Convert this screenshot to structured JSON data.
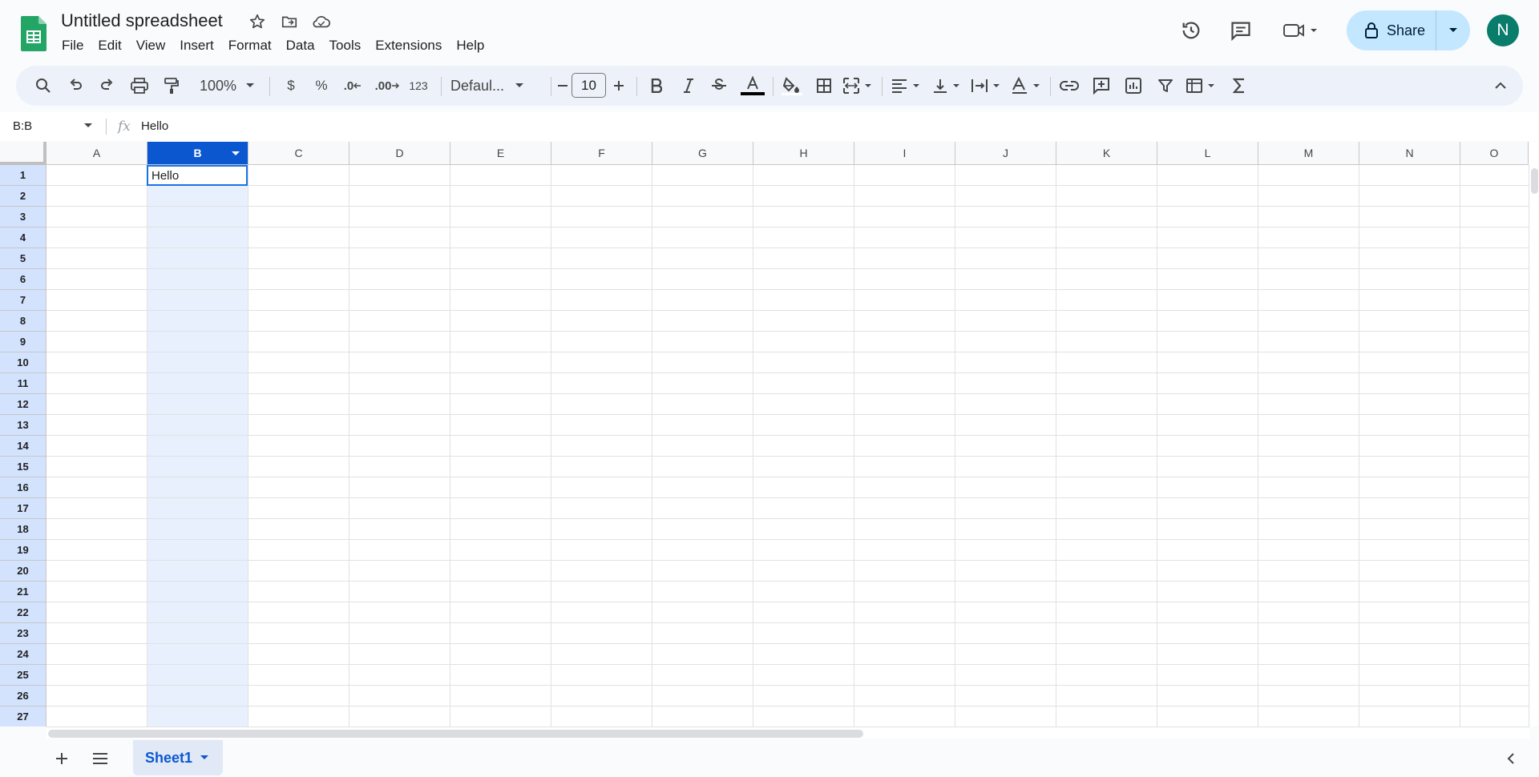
{
  "app": {
    "title": "Untitled spreadsheet",
    "menu": [
      "File",
      "Edit",
      "View",
      "Insert",
      "Format",
      "Data",
      "Tools",
      "Extensions",
      "Help"
    ],
    "share_label": "Share",
    "avatar_initial": "N",
    "accent": "#0b57d0"
  },
  "toolbar": {
    "zoom": "100%",
    "currency": "$",
    "percent": "%",
    "decrease_decimal": ".0",
    "increase_decimal": ".00",
    "number_format": "123",
    "font": "Defaul...",
    "font_size": "10"
  },
  "formula_bar": {
    "name_box": "B:B",
    "fx": "fx",
    "content": "Hello"
  },
  "grid": {
    "columns": [
      "A",
      "B",
      "C",
      "D",
      "E",
      "F",
      "G",
      "H",
      "I",
      "J",
      "K",
      "L",
      "M",
      "N",
      "O"
    ],
    "selected_column": "B",
    "rows": [
      "1",
      "2",
      "3",
      "4",
      "5",
      "6",
      "7",
      "8",
      "9",
      "10",
      "11",
      "12",
      "13",
      "14",
      "15",
      "16",
      "17",
      "18",
      "19",
      "20",
      "21",
      "22",
      "23",
      "24",
      "25",
      "26",
      "27"
    ],
    "active_cell_value": "Hello"
  },
  "sheets": {
    "active": "Sheet1"
  }
}
